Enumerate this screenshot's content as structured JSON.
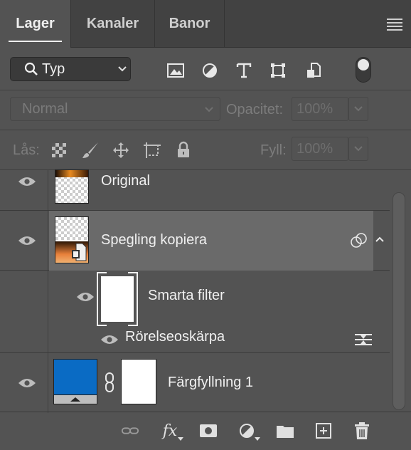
{
  "tabs": [
    {
      "label": "Lager"
    },
    {
      "label": "Kanaler"
    },
    {
      "label": "Banor"
    }
  ],
  "filter": {
    "selected": "Typ",
    "icons": [
      "image-filter-icon",
      "adjustment-filter-icon",
      "type-filter-icon",
      "shape-filter-icon",
      "smart-object-filter-icon"
    ]
  },
  "blend": {
    "mode": "Normal",
    "opacity_label": "Opacitet:",
    "opacity_value": "100%"
  },
  "lock": {
    "label": "Lås:",
    "fill_label": "Fyll:",
    "fill_value": "100%"
  },
  "layers": [
    {
      "name": "Original"
    },
    {
      "name": "Spegling kopiera",
      "selected": true
    },
    {
      "name": "Smarta filter"
    },
    {
      "name": "Rörelseoskärpa"
    },
    {
      "name": "Färgfyllning 1",
      "fill_color": "#0a6bc4"
    }
  ],
  "colors": {
    "panel": "#535353",
    "tabbar": "#424242",
    "selected_row": "#6a6a6a",
    "fill_layer": "#0a6bc4"
  }
}
